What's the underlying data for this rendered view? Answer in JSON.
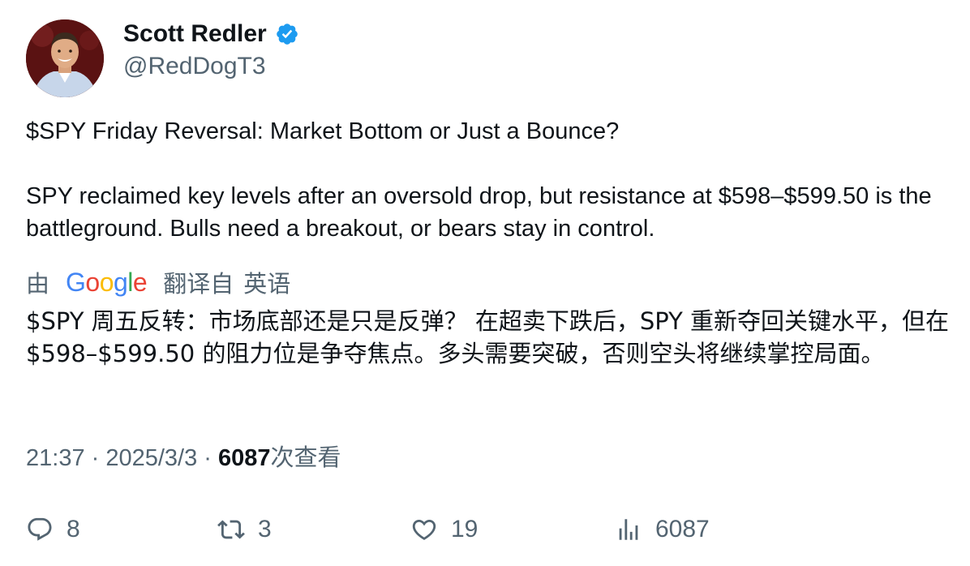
{
  "author": {
    "display_name": "Scott Redler",
    "handle": "@RedDogT3",
    "verified": true,
    "verified_color": "#1d9bf0"
  },
  "tweet": {
    "paragraphs": [
      "$SPY Friday Reversal: Market Bottom or Just a Bounce?",
      "SPY reclaimed key levels after an oversold drop, but resistance at $598–$599.50 is the battleground. Bulls need a breakout, or bears stay in control."
    ]
  },
  "translation": {
    "prefix": "由",
    "provider_letters": [
      "G",
      "o",
      "o",
      "g",
      "l",
      "e"
    ],
    "label": "翻译自",
    "source_language": "英语",
    "text": "$SPY 周五反转：市场底部还是只是反弹？ 在超卖下跌后，SPY 重新夺回关键水平，但在 $598–$599.50 的阻力位是争夺焦点。多头需要突破，否则空头将继续掌控局面。"
  },
  "meta": {
    "time": "21:37",
    "separator": " · ",
    "date": "2025/3/3",
    "views_count": "6087",
    "views_label": "次查看"
  },
  "actions": {
    "reply_count": "8",
    "retweet_count": "3",
    "like_count": "19",
    "views_count": "6087"
  },
  "icons": {
    "avatar": "avatar-photo",
    "verified": "verified-badge-icon",
    "reply": "reply-icon",
    "retweet": "retweet-icon",
    "like": "heart-icon",
    "views": "analytics-icon"
  },
  "colors": {
    "text_primary": "#0f1419",
    "text_secondary": "#536471",
    "google_blue": "#4285f4",
    "google_red": "#ea4335",
    "google_yellow": "#fbbc05",
    "google_green": "#34a853"
  }
}
